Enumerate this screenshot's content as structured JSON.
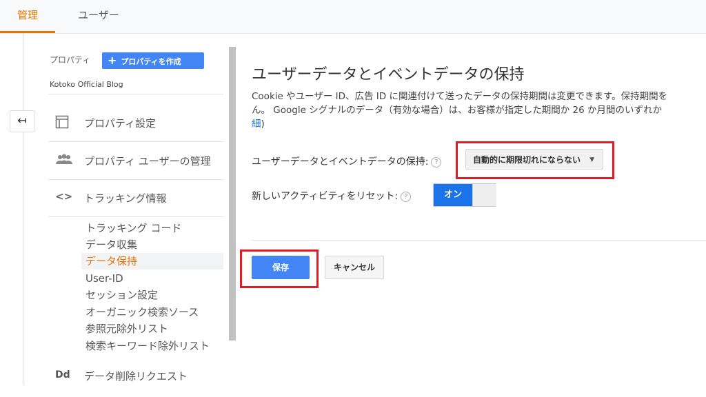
{
  "top_tabs": [
    {
      "label": "管理",
      "active": true
    },
    {
      "label": "ユーザー",
      "active": false
    }
  ],
  "back_icon": "back-arrow-icon",
  "sidebar": {
    "property_label": "プロパティ",
    "create_button": "プロパティを作成",
    "property_name": "Kotoko Official Blog",
    "nav": [
      {
        "label": "プロパティ設定",
        "icon": "property-settings-icon",
        "glyph": "▢"
      },
      {
        "label": "プロパティ ユーザーの管理",
        "icon": "users-icon",
        "glyph": "👥"
      },
      {
        "label": "トラッキング情報",
        "icon": "code-icon",
        "glyph": "<>"
      }
    ],
    "tracking_items": [
      {
        "label": "トラッキング コード",
        "active": false
      },
      {
        "label": "データ収集",
        "active": false
      },
      {
        "label": "データ保持",
        "active": true
      },
      {
        "label": "User-ID",
        "active": false
      },
      {
        "label": "セッション設定",
        "active": false
      },
      {
        "label": "オーガニック検索ソース",
        "active": false
      },
      {
        "label": "参照元除外リスト",
        "active": false
      },
      {
        "label": "検索キーワード除外リスト",
        "active": false
      }
    ],
    "delete_request": {
      "icon_text": "Dd",
      "label": "データ削除リクエスト"
    }
  },
  "main": {
    "title": "ユーザーデータとイベントデータの保持",
    "desc_line1": "Cookie やユーザー ID、広告 ID に関連付けて送ったデータの保持期間は変更できます。保持期間を",
    "desc_line2": "ん。 Google シグナルのデータ（有効な場合）は、お客様が指定した期間か 26 か月間のいずれか",
    "desc_link": "細",
    "desc_paren": ")",
    "retention_label": "ユーザーデータとイベントデータの保持:",
    "retention_value": "自動的に期限切れにならない",
    "reset_label": "新しいアクティビティをリセット:",
    "reset_toggle": "オン",
    "help_glyph": "?",
    "save": "保存",
    "cancel": "キャンセル"
  },
  "colors": {
    "accent": "#e37400",
    "primary": "#4285f4",
    "highlight": "#e01b24"
  }
}
